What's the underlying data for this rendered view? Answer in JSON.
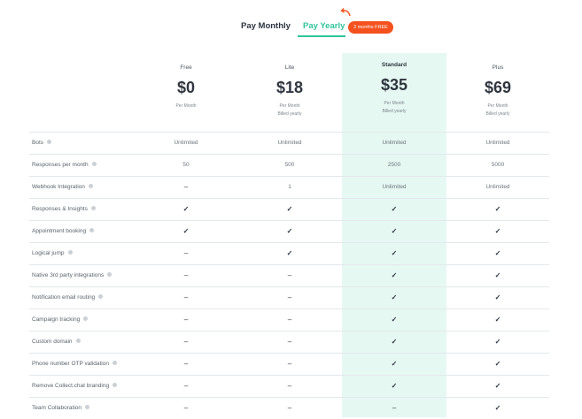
{
  "toggle": {
    "monthly_label": "Pay Monthly",
    "yearly_label": "Pay Yearly",
    "promo_badge": "3 months FREE",
    "selected": "Pay Yearly"
  },
  "plans": [
    {
      "name": "Free",
      "price": "$0",
      "period": "Per Month",
      "billing": ""
    },
    {
      "name": "Lite",
      "price": "$18",
      "period": "Per Month",
      "billing": "Billed yearly"
    },
    {
      "name": "Standard",
      "price": "$35",
      "period": "Per Month",
      "billing": "Billed yearly"
    },
    {
      "name": "Plus",
      "price": "$69",
      "period": "Per Month",
      "billing": "Billed yearly"
    }
  ],
  "features": [
    {
      "name": "Bots",
      "values": [
        "Unlimited",
        "Unlimited",
        "Unlimited",
        "Unlimited"
      ]
    },
    {
      "name": "Responses per month",
      "values": [
        "50",
        "500",
        "2500",
        "5000"
      ]
    },
    {
      "name": "Webhook Integration",
      "values": [
        "–",
        "1",
        "Unlimited",
        "Unlimited"
      ]
    },
    {
      "name": "Responses & Insights",
      "values": [
        "✓",
        "✓",
        "✓",
        "✓"
      ]
    },
    {
      "name": "Appointment booking",
      "values": [
        "✓",
        "✓",
        "✓",
        "✓"
      ]
    },
    {
      "name": "Logical jump",
      "values": [
        "–",
        "✓",
        "✓",
        "✓"
      ]
    },
    {
      "name": "Native 3rd party integrations",
      "values": [
        "–",
        "–",
        "✓",
        "✓"
      ]
    },
    {
      "name": "Notification email routing",
      "values": [
        "–",
        "–",
        "✓",
        "✓"
      ]
    },
    {
      "name": "Campaign tracking",
      "values": [
        "–",
        "–",
        "✓",
        "✓"
      ]
    },
    {
      "name": "Custom domain",
      "values": [
        "–",
        "–",
        "✓",
        "✓"
      ]
    },
    {
      "name": "Phone number OTP validation",
      "values": [
        "–",
        "–",
        "✓",
        "✓"
      ]
    },
    {
      "name": "Remove Collect.chat branding",
      "values": [
        "–",
        "–",
        "✓",
        "✓"
      ]
    },
    {
      "name": "Team Collaboration",
      "values": [
        "–",
        "–",
        "–",
        "✓"
      ]
    }
  ],
  "colors": {
    "accent": "#2fc49a",
    "badge": "#f4511e",
    "highlight": "#e6f8f2"
  }
}
